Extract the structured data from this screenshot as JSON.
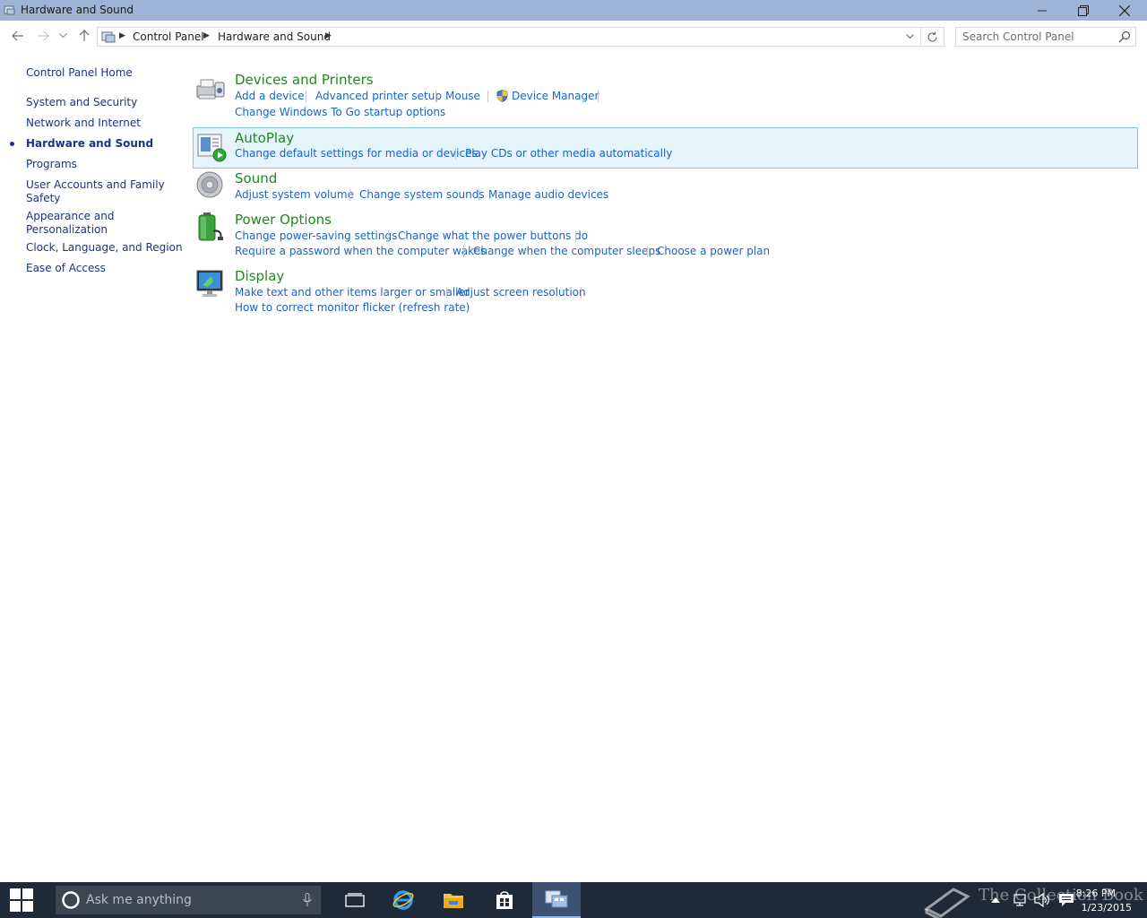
{
  "window": {
    "title": "Hardware and Sound"
  },
  "address": {
    "crumbs": [
      "Control Panel",
      "Hardware and Sound"
    ]
  },
  "search": {
    "placeholder": "Search Control Panel"
  },
  "sidebar": {
    "items": [
      {
        "label": "Control Panel Home"
      },
      {
        "label": "System and Security"
      },
      {
        "label": "Network and Internet"
      },
      {
        "label": "Hardware and Sound",
        "current": true
      },
      {
        "label": "Programs"
      },
      {
        "label": "User Accounts and Family"
      },
      {
        "label": "Safety"
      },
      {
        "label": "Appearance and"
      },
      {
        "label": "Personalization"
      },
      {
        "label": "Clock, Language, and Region"
      },
      {
        "label": "Ease of Access"
      }
    ]
  },
  "categories": [
    {
      "title": "Devices and Printers",
      "icon": "printer-icon",
      "tasks": [
        "Add a device",
        "Advanced printer setup",
        "Mouse",
        "Device Manager",
        "Change Windows To Go startup options"
      ]
    },
    {
      "title": "AutoPlay",
      "icon": "autoplay-icon",
      "tasks": [
        "Change default settings for media or devices",
        "Play CDs or other media automatically"
      ]
    },
    {
      "title": "Sound",
      "icon": "speaker-icon",
      "tasks": [
        "Adjust system volume",
        "Change system sounds",
        "Manage audio devices"
      ]
    },
    {
      "title": "Power Options",
      "icon": "battery-icon",
      "tasks": [
        "Change power-saving settings",
        "Change what the power buttons do",
        "Require a password when the computer wakes",
        "Change when the computer sleeps",
        "Choose a power plan"
      ]
    },
    {
      "title": "Display",
      "icon": "monitor-icon",
      "tasks": [
        "Make text and other items larger or smaller",
        "Adjust screen resolution",
        "How to correct monitor flicker (refresh rate)"
      ]
    }
  ],
  "taskbar": {
    "search_placeholder": "Ask me anything",
    "time": "8:26 PM",
    "date": "1/23/2015",
    "watermark": "The Collection Book"
  },
  "colors": {
    "titlebar": "#9eb3d6",
    "category_title": "#1c8a1c",
    "task_link": "#1765c7",
    "nav_link": "#1e3287",
    "highlight_bg": "#e5f3fb",
    "highlight_border": "#84c6ea",
    "taskbar": "#1e2a37"
  }
}
